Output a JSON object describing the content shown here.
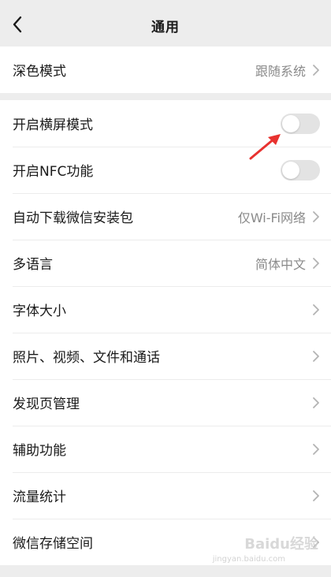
{
  "header": {
    "title": "通用"
  },
  "group1": [
    {
      "label": "深色模式",
      "value": "跟随系统"
    }
  ],
  "group2": [
    {
      "label": "开启横屏模式",
      "type": "toggle",
      "on": false
    },
    {
      "label": "开启NFC功能",
      "type": "toggle",
      "on": false
    },
    {
      "label": "自动下载微信安装包",
      "value": "仅Wi-Fi网络"
    },
    {
      "label": "多语言",
      "value": "简体中文"
    },
    {
      "label": "字体大小"
    },
    {
      "label": "照片、视频、文件和通话"
    },
    {
      "label": "发现页管理"
    },
    {
      "label": "辅助功能"
    },
    {
      "label": "流量统计"
    },
    {
      "label": "微信存储空间"
    }
  ],
  "watermark": {
    "text": "Baidu经验",
    "url": "jingyan.baidu.com"
  },
  "colors": {
    "background": "#ededed",
    "toggle_off": "#e3e3e3",
    "annotation_arrow": "#e8322f"
  },
  "icons": [
    "back-chevron-icon",
    "chevron-right-icon",
    "annotation-arrow-icon"
  ]
}
